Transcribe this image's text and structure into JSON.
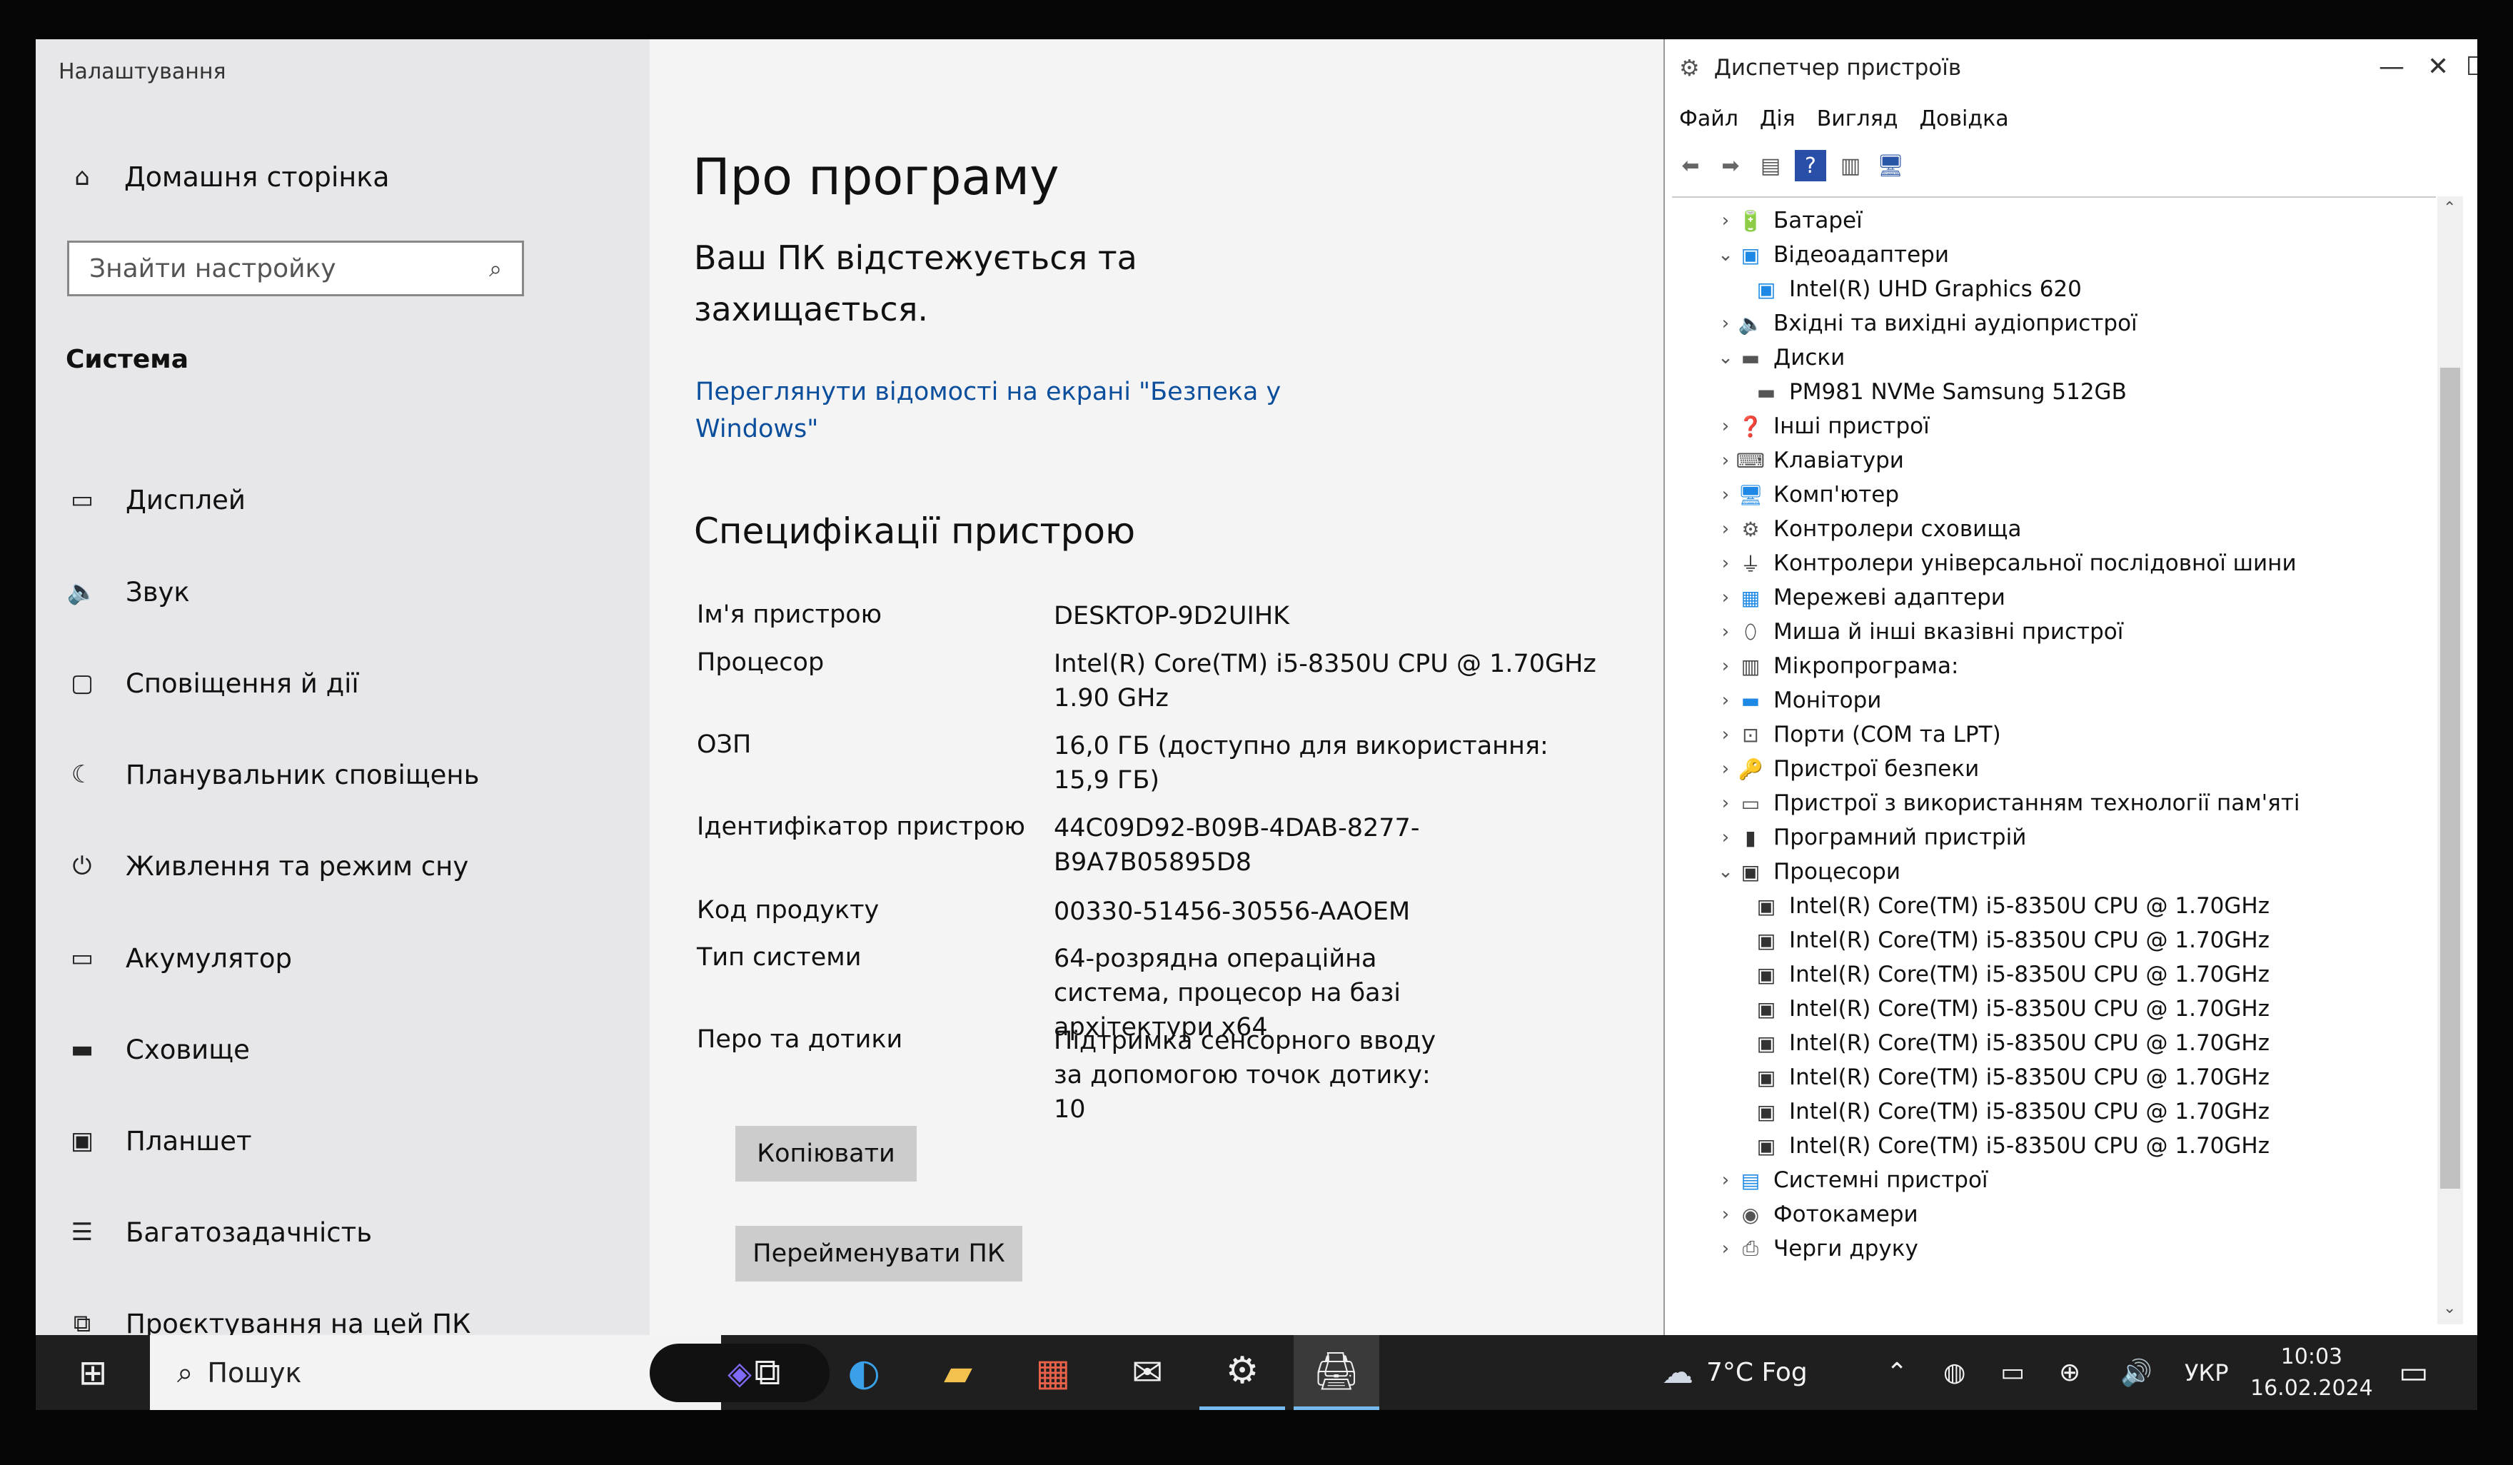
{
  "settings": {
    "window_title": "Налаштування",
    "home_label": "Домашня сторінка",
    "search_placeholder": "Знайти настройку",
    "section_label": "Система",
    "nav": [
      {
        "label": "Дисплей",
        "icon": "display-icon"
      },
      {
        "label": "Звук",
        "icon": "speaker-icon"
      },
      {
        "label": "Сповіщення й дії",
        "icon": "notifications-icon"
      },
      {
        "label": "Планувальник сповіщень",
        "icon": "moon-icon"
      },
      {
        "label": "Живлення та режим сну",
        "icon": "power-icon"
      },
      {
        "label": "Акумулятор",
        "icon": "battery-icon"
      },
      {
        "label": "Сховище",
        "icon": "storage-icon"
      },
      {
        "label": "Планшет",
        "icon": "tablet-icon"
      },
      {
        "label": "Багатозадачність",
        "icon": "multitasking-icon"
      },
      {
        "label": "Проєктування на цей ПК",
        "icon": "projecting-icon"
      }
    ],
    "content": {
      "title": "Про програму",
      "status": "Ваш ПК відстежується та захищається.",
      "security_link": "Переглянути відомості на екрані \"Безпека у Windows\"",
      "spec_heading": "Специфікації пристрою",
      "specs": [
        {
          "label": "Ім'я пристрою",
          "value": "DESKTOP-9D2UIHK"
        },
        {
          "label": "Процесор",
          "value": "Intel(R) Core(TM) i5-8350U CPU @ 1.70GHz   1.90 GHz"
        },
        {
          "label": "ОЗП",
          "value": "16,0 ГБ (доступно для використання: 15,9 ГБ)"
        },
        {
          "label": "Ідентифікатор пристрою",
          "value": "44C09D92-B09B-4DAB-8277-B9A7B05895D8"
        },
        {
          "label": "Код продукту",
          "value": "00330-51456-30556-AAOEM"
        },
        {
          "label": "Тип системи",
          "value": "64-розрядна операційна система, процесор на базі архітектури x64"
        },
        {
          "label": "Перо та дотики",
          "value": "Підтримка сенсорного вводу за допомогою точок дотику: 10"
        }
      ],
      "copy_button": "Копіювати",
      "rename_button": "Перейменувати ПК"
    }
  },
  "device_manager": {
    "title": "Диспетчер пристроїв",
    "menu": [
      "Файл",
      "Дія",
      "Вигляд",
      "Довідка"
    ],
    "tree": [
      {
        "label": "Батареї",
        "level": 0,
        "expanded": false,
        "icon": "battery-device-icon"
      },
      {
        "label": "Відеоадаптери",
        "level": 0,
        "expanded": true,
        "icon": "display-adapter-icon"
      },
      {
        "label": "Intel(R) UHD Graphics 620",
        "level": 1,
        "icon": "display-adapter-icon"
      },
      {
        "label": "Вхідні та вихідні аудіопристрої",
        "level": 0,
        "expanded": false,
        "icon": "audio-device-icon"
      },
      {
        "label": "Диски",
        "level": 0,
        "expanded": true,
        "icon": "disk-drive-icon"
      },
      {
        "label": "PM981 NVMe Samsung 512GB",
        "level": 1,
        "icon": "disk-drive-icon"
      },
      {
        "label": "Інші пристрої",
        "level": 0,
        "expanded": false,
        "icon": "other-devices-icon"
      },
      {
        "label": "Клавіатури",
        "level": 0,
        "expanded": false,
        "icon": "keyboard-icon"
      },
      {
        "label": "Комп'ютер",
        "level": 0,
        "expanded": false,
        "icon": "computer-icon"
      },
      {
        "label": "Контролери сховища",
        "level": 0,
        "expanded": false,
        "icon": "storage-controller-icon"
      },
      {
        "label": "Контролери універсальної послідовної шини",
        "level": 0,
        "expanded": false,
        "icon": "usb-icon"
      },
      {
        "label": "Мережеві адаптери",
        "level": 0,
        "expanded": false,
        "icon": "network-adapter-icon"
      },
      {
        "label": "Миша й інші вказівні пристрої",
        "level": 0,
        "expanded": false,
        "icon": "mouse-icon"
      },
      {
        "label": "Мікропрограма:",
        "level": 0,
        "expanded": false,
        "icon": "firmware-icon"
      },
      {
        "label": "Монітори",
        "level": 0,
        "expanded": false,
        "icon": "monitor-icon"
      },
      {
        "label": "Порти (COM та LPT)",
        "level": 0,
        "expanded": false,
        "icon": "port-icon"
      },
      {
        "label": "Пристрої безпеки",
        "level": 0,
        "expanded": false,
        "icon": "security-device-icon"
      },
      {
        "label": "Пристрої з використанням технології пам'яті",
        "level": 0,
        "expanded": false,
        "icon": "memory-device-icon"
      },
      {
        "label": "Програмний пристрій",
        "level": 0,
        "expanded": false,
        "icon": "software-device-icon"
      },
      {
        "label": "Процесори",
        "level": 0,
        "expanded": true,
        "icon": "processor-icon"
      },
      {
        "label": "Intel(R) Core(TM) i5-8350U CPU @ 1.70GHz",
        "level": 1,
        "icon": "processor-icon"
      },
      {
        "label": "Intel(R) Core(TM) i5-8350U CPU @ 1.70GHz",
        "level": 1,
        "icon": "processor-icon"
      },
      {
        "label": "Intel(R) Core(TM) i5-8350U CPU @ 1.70GHz",
        "level": 1,
        "icon": "processor-icon"
      },
      {
        "label": "Intel(R) Core(TM) i5-8350U CPU @ 1.70GHz",
        "level": 1,
        "icon": "processor-icon"
      },
      {
        "label": "Intel(R) Core(TM) i5-8350U CPU @ 1.70GHz",
        "level": 1,
        "icon": "processor-icon"
      },
      {
        "label": "Intel(R) Core(TM) i5-8350U CPU @ 1.70GHz",
        "level": 1,
        "icon": "processor-icon"
      },
      {
        "label": "Intel(R) Core(TM) i5-8350U CPU @ 1.70GHz",
        "level": 1,
        "icon": "processor-icon"
      },
      {
        "label": "Intel(R) Core(TM) i5-8350U CPU @ 1.70GHz",
        "level": 1,
        "icon": "processor-icon"
      },
      {
        "label": "Системні пристрої",
        "level": 0,
        "expanded": false,
        "icon": "system-device-icon"
      },
      {
        "label": "Фотокамери",
        "level": 0,
        "expanded": false,
        "icon": "camera-icon"
      },
      {
        "label": "Черги друку",
        "level": 0,
        "expanded": false,
        "icon": "printer-icon"
      }
    ]
  },
  "taskbar": {
    "search_placeholder": "Пошук",
    "weather": "7°C Fog",
    "language": "УКР",
    "time": "10:03",
    "date": "16.02.2024"
  },
  "colors": {
    "link": "#0b4e9c",
    "taskbar": "#1f1f1f",
    "accent": "#0078d4"
  }
}
